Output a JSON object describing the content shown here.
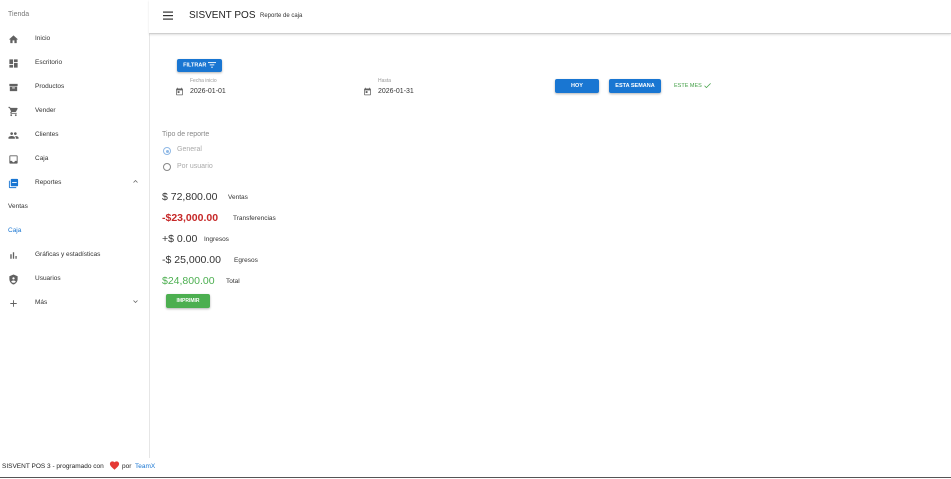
{
  "sidebar": {
    "store_label": "Tienda",
    "items": [
      {
        "label": "Inicio",
        "icon": "home-icon"
      },
      {
        "label": "Escritorio",
        "icon": "dashboard-icon"
      },
      {
        "label": "Productos",
        "icon": "inventory-icon"
      },
      {
        "label": "Vender",
        "icon": "cart-icon"
      },
      {
        "label": "Clientes",
        "icon": "people-icon"
      },
      {
        "label": "Caja",
        "icon": "inbox-icon"
      },
      {
        "label": "Reportes",
        "icon": "library-icon"
      },
      {
        "label": "Gráficas y estadísticas",
        "icon": "bar-chart-icon"
      },
      {
        "label": "Usuarios",
        "icon": "shield-icon"
      },
      {
        "label": "Más",
        "icon": "plus-icon"
      }
    ],
    "reportes_sub": [
      "Ventas",
      "Caja"
    ]
  },
  "header": {
    "title": "SISVENT POS",
    "subtitle": "Reporte de caja"
  },
  "filters": {
    "filter_button": "FILTRAR",
    "from_label": "Fecha inicio",
    "from_value": "2026-01-01",
    "to_label": "Hasta",
    "to_value": "2026-01-31",
    "today_button": "HOY",
    "week_button": "ESTA SEMANA",
    "month_button": "ESTE MES"
  },
  "report_type": {
    "label": "Tipo de reporte",
    "options": [
      "General",
      "Por usuario"
    ],
    "selected": "General"
  },
  "summary": {
    "ventas": {
      "amount": "$ 72,800.00",
      "label": "Ventas"
    },
    "transferencias": {
      "amount": "-$23,000.00",
      "label": "Transferencias"
    },
    "ingresos": {
      "amount": "+$ 0.00",
      "label": "Ingresos"
    },
    "egresos": {
      "amount": "-$ 25,000.00",
      "label": "Egresos"
    },
    "total": {
      "amount": "$24,800.00",
      "label": "Total"
    }
  },
  "print_button": "IMPRIMIR",
  "footer": {
    "prefix": "SISVENT POS 3 - programado con",
    "by": "por",
    "author": "TeamX"
  },
  "colors": {
    "primary": "#1976d2",
    "success": "#4caf50",
    "negative": "#c62828",
    "heart": "#e53935",
    "icon": "#616161"
  }
}
